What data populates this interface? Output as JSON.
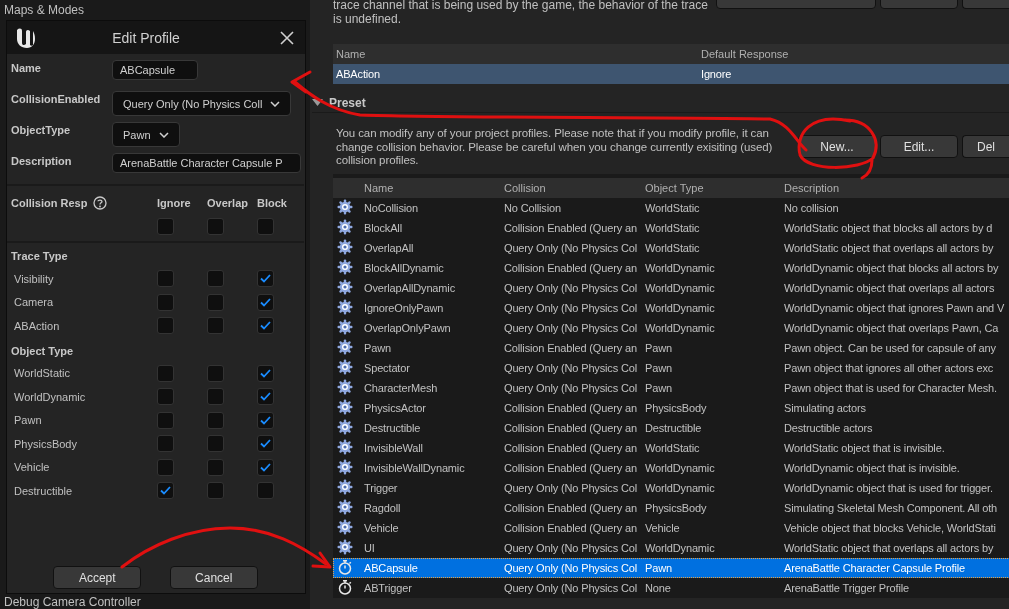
{
  "background_panel": {
    "items": [
      "Maps & Modes",
      "Debug Camera Controller"
    ]
  },
  "dialog": {
    "title": "Edit Profile",
    "fields": [
      {
        "label": "Name",
        "kind": "text",
        "value": "ABCapsule"
      },
      {
        "label": "CollisionEnabled",
        "kind": "dropdown",
        "value": "Query Only (No Physics Coll"
      },
      {
        "label": "ObjectType",
        "kind": "dropdown",
        "value": "Pawn"
      },
      {
        "label": "Description",
        "kind": "text",
        "value": "ArenaBattle Character Capsule P"
      }
    ],
    "responses": {
      "label": "Collision Resp",
      "columns": [
        "Ignore",
        "Overlap",
        "Block"
      ],
      "all": [
        false,
        false,
        false
      ],
      "groups": [
        {
          "title": "Trace Type",
          "rows": [
            {
              "name": "Visibility",
              "checks": [
                false,
                false,
                true
              ]
            },
            {
              "name": "Camera",
              "checks": [
                false,
                false,
                true
              ]
            },
            {
              "name": "ABAction",
              "checks": [
                false,
                false,
                true
              ]
            }
          ]
        },
        {
          "title": "Object Type",
          "rows": [
            {
              "name": "WorldStatic",
              "checks": [
                false,
                false,
                true
              ]
            },
            {
              "name": "WorldDynamic",
              "checks": [
                false,
                false,
                true
              ]
            },
            {
              "name": "Pawn",
              "checks": [
                false,
                false,
                true
              ]
            },
            {
              "name": "PhysicsBody",
              "checks": [
                false,
                false,
                true
              ]
            },
            {
              "name": "Vehicle",
              "checks": [
                false,
                false,
                true
              ]
            },
            {
              "name": "Destructible",
              "checks": [
                true,
                false,
                false
              ]
            }
          ]
        }
      ]
    },
    "buttons": [
      "Accept",
      "Cancel"
    ]
  },
  "trace_channels": {
    "note": "trace channel that is being used by the game, the behavior of the trace is undefined.",
    "columns": [
      "Name",
      "Default Response"
    ],
    "rows": [
      {
        "cells": [
          "ABAction",
          "Ignore"
        ],
        "selected": true
      }
    ]
  },
  "preset": {
    "title": "Preset",
    "expanded": true,
    "note": "You can modify any of your project profiles. Please note that if you modify profile, it can change collision behavior. Please be careful when you change currently exisiting (used) collision profiles.",
    "buttons": [
      "New...",
      "Edit...",
      "Del"
    ],
    "columns": [
      "Name",
      "Collision",
      "Object Type",
      "Description"
    ],
    "rows": [
      {
        "kind": "engine",
        "cells": [
          "NoCollision",
          "No Collision",
          "WorldStatic",
          "No collision"
        ],
        "selected": false
      },
      {
        "kind": "engine",
        "cells": [
          "BlockAll",
          "Collision Enabled (Query an",
          "WorldStatic",
          "WorldStatic object that blocks all actors by d"
        ],
        "selected": false
      },
      {
        "kind": "engine",
        "cells": [
          "OverlapAll",
          "Query Only (No Physics Col",
          "WorldStatic",
          "WorldStatic object that overlaps all actors by"
        ],
        "selected": false
      },
      {
        "kind": "engine",
        "cells": [
          "BlockAllDynamic",
          "Collision Enabled (Query an",
          "WorldDynamic",
          "WorldDynamic object that blocks all actors by"
        ],
        "selected": false
      },
      {
        "kind": "engine",
        "cells": [
          "OverlapAllDynamic",
          "Query Only (No Physics Col",
          "WorldDynamic",
          "WorldDynamic object that overlaps all actors"
        ],
        "selected": false
      },
      {
        "kind": "engine",
        "cells": [
          "IgnoreOnlyPawn",
          "Query Only (No Physics Col",
          "WorldDynamic",
          "WorldDynamic object that ignores Pawn and V"
        ],
        "selected": false
      },
      {
        "kind": "engine",
        "cells": [
          "OverlapOnlyPawn",
          "Query Only (No Physics Col",
          "WorldDynamic",
          "WorldDynamic object that overlaps Pawn, Ca"
        ],
        "selected": false
      },
      {
        "kind": "engine",
        "cells": [
          "Pawn",
          "Collision Enabled (Query an",
          "Pawn",
          "Pawn object. Can be used for capsule of any"
        ],
        "selected": false
      },
      {
        "kind": "engine",
        "cells": [
          "Spectator",
          "Query Only (No Physics Col",
          "Pawn",
          "Pawn object that ignores all other actors exc"
        ],
        "selected": false
      },
      {
        "kind": "engine",
        "cells": [
          "CharacterMesh",
          "Query Only (No Physics Col",
          "Pawn",
          "Pawn object that is used for Character Mesh."
        ],
        "selected": false
      },
      {
        "kind": "engine",
        "cells": [
          "PhysicsActor",
          "Collision Enabled (Query an",
          "PhysicsBody",
          "Simulating actors"
        ],
        "selected": false
      },
      {
        "kind": "engine",
        "cells": [
          "Destructible",
          "Collision Enabled (Query an",
          "Destructible",
          "Destructible actors"
        ],
        "selected": false
      },
      {
        "kind": "engine",
        "cells": [
          "InvisibleWall",
          "Collision Enabled (Query an",
          "WorldStatic",
          "WorldStatic object that is invisible."
        ],
        "selected": false
      },
      {
        "kind": "engine",
        "cells": [
          "InvisibleWallDynamic",
          "Collision Enabled (Query an",
          "WorldDynamic",
          "WorldDynamic object that is invisible."
        ],
        "selected": false
      },
      {
        "kind": "engine",
        "cells": [
          "Trigger",
          "Query Only (No Physics Col",
          "WorldDynamic",
          "WorldDynamic object that is used for trigger."
        ],
        "selected": false
      },
      {
        "kind": "engine",
        "cells": [
          "Ragdoll",
          "Collision Enabled (Query an",
          "PhysicsBody",
          "Simulating Skeletal Mesh Component. All oth"
        ],
        "selected": false
      },
      {
        "kind": "engine",
        "cells": [
          "Vehicle",
          "Collision Enabled (Query an",
          "Vehicle",
          "Vehicle object that blocks Vehicle, WorldStati"
        ],
        "selected": false
      },
      {
        "kind": "engine",
        "cells": [
          "UI",
          "Query Only (No Physics Col",
          "WorldDynamic",
          "WorldStatic object that overlaps all actors by"
        ],
        "selected": false
      },
      {
        "kind": "project",
        "cells": [
          "ABCapsule",
          "Query Only (No Physics Col",
          "Pawn",
          "ArenaBattle Character Capsule Profile"
        ],
        "selected": true
      },
      {
        "kind": "project",
        "cells": [
          "ABTrigger",
          "Query Only (No Physics Col",
          "None",
          "ArenaBattle Trigger Profile"
        ],
        "selected": false
      }
    ]
  }
}
